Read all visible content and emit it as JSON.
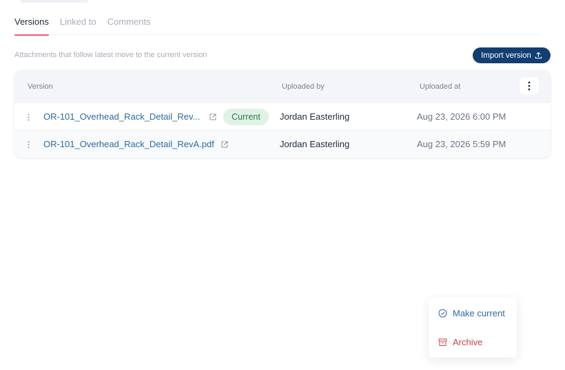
{
  "tabs": [
    {
      "label": "Versions",
      "active": true
    },
    {
      "label": "Linked to",
      "active": false
    },
    {
      "label": "Comments",
      "active": false
    }
  ],
  "hint": "Attachments that follow latest move to the current version",
  "import_button": {
    "label": "Import version",
    "icon": "upload-icon"
  },
  "table": {
    "headers": {
      "version": "Version",
      "uploaded_by": "Uploaded by",
      "uploaded_at": "Uploaded at"
    },
    "rows": [
      {
        "file": "OR-101_Overhead_Rack_Detail_Rev...",
        "badge": "Current",
        "uploaded_by": "Jordan Easterling",
        "uploaded_at": "Aug 23, 2026 6:00 PM"
      },
      {
        "file": "OR-101_Overhead_Rack_Detail_RevA.pdf",
        "badge": "",
        "uploaded_by": "Jordan Easterling",
        "uploaded_at": "Aug 23, 2026 5:59 PM"
      }
    ]
  },
  "context_menu": {
    "make_current": {
      "label": "Make current",
      "icon": "check-circle-icon"
    },
    "archive": {
      "label": "Archive",
      "icon": "archive-box-icon"
    }
  },
  "colors": {
    "accent": "#123e72",
    "link": "#2e6a9e",
    "tab_indicator": "#e4606d",
    "badge_bg": "#dff2e5",
    "badge_text": "#2c7a4b",
    "danger": "#c8434c"
  }
}
